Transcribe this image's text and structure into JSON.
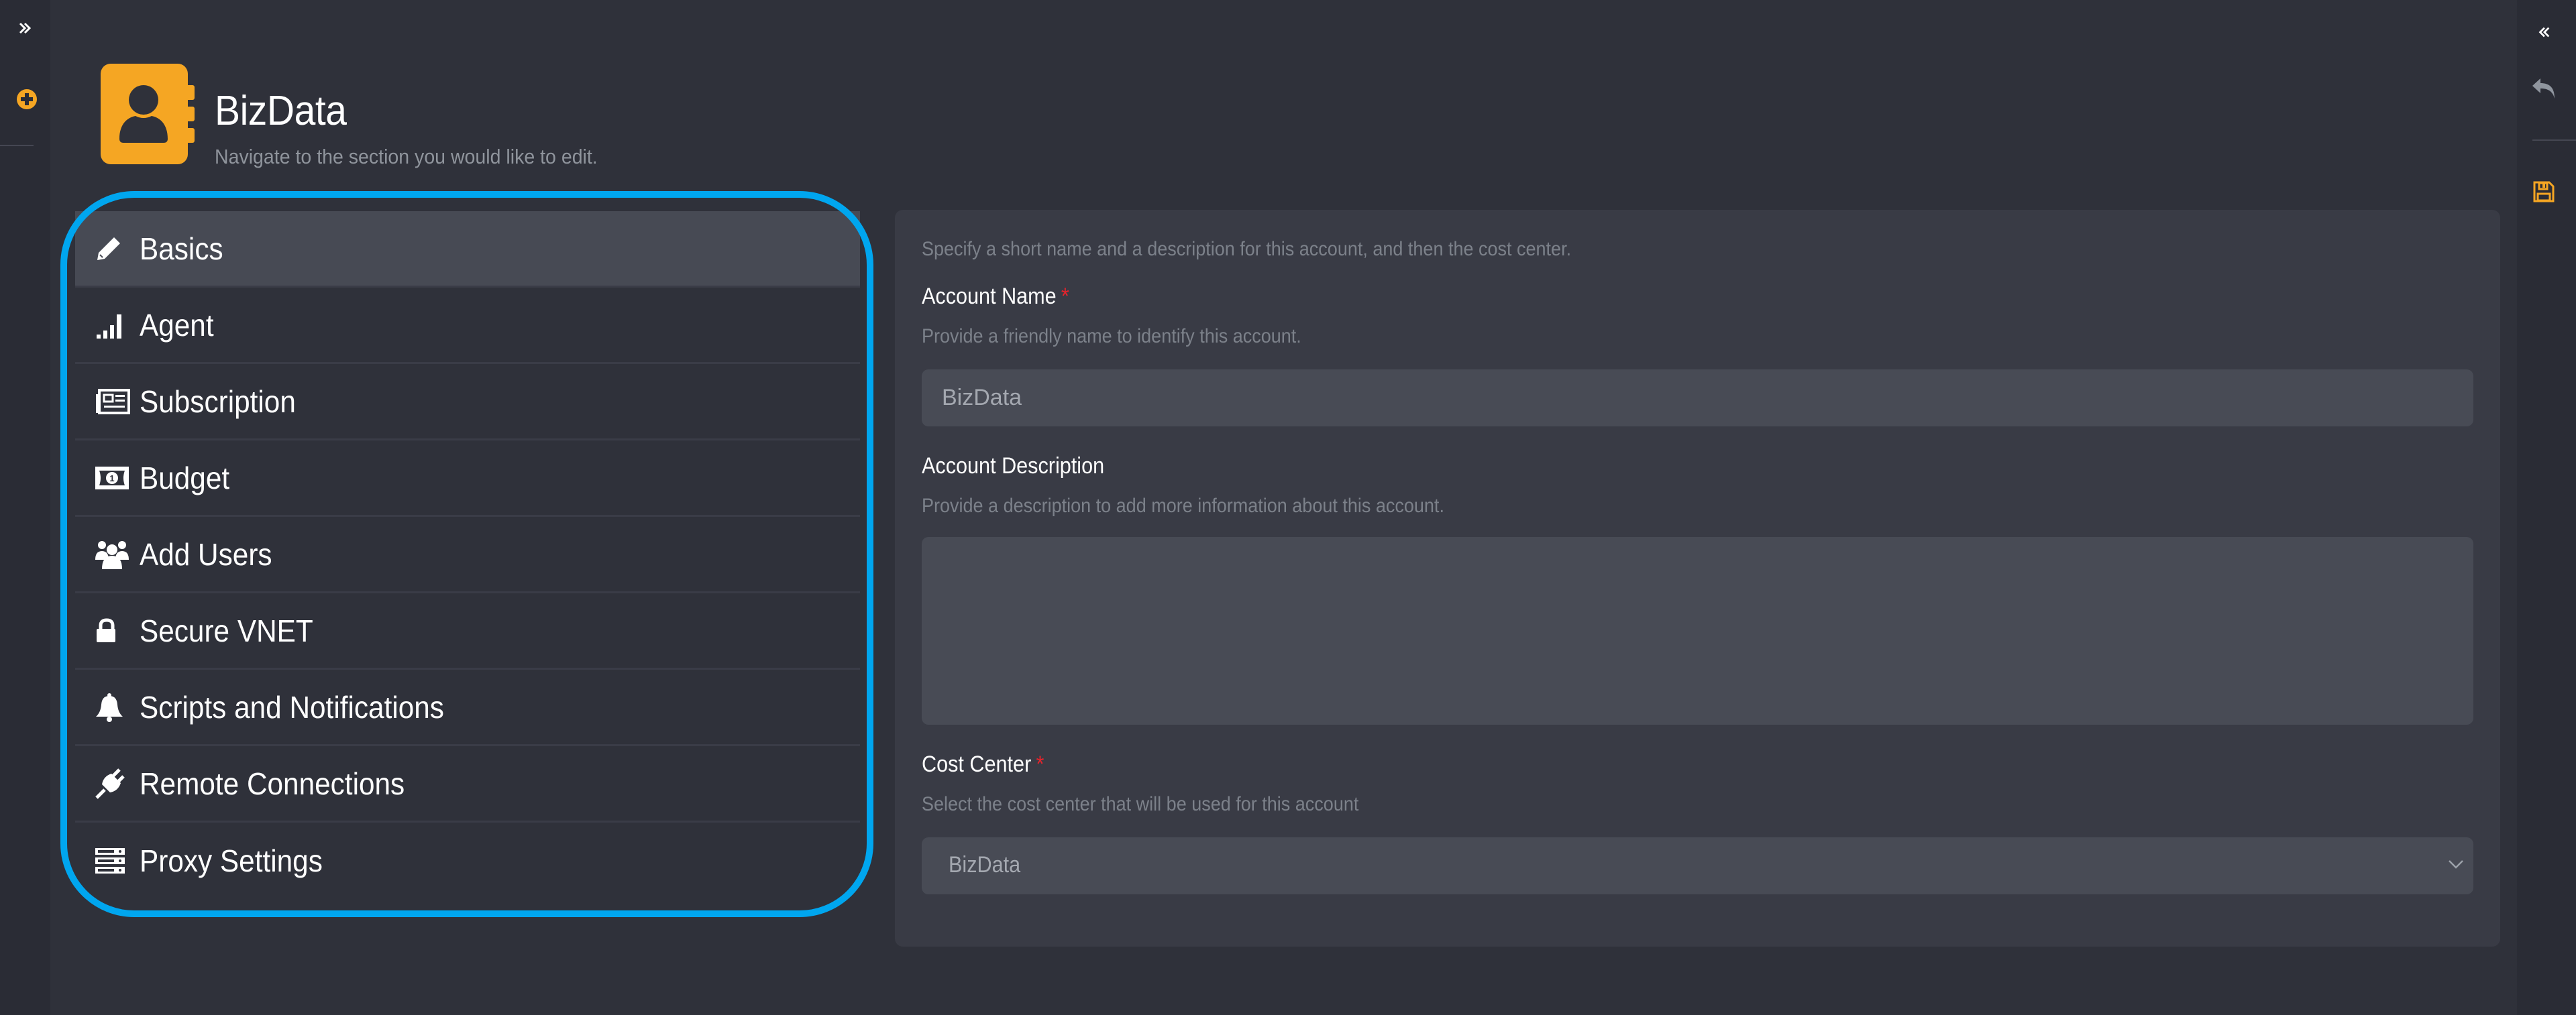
{
  "left_rail": {
    "expand_icon": "chevrons-right-icon",
    "add_icon": "plus-circle-icon"
  },
  "right_rail": {
    "collapse_icon": "chevrons-left-icon",
    "undo_icon": "undo-icon",
    "save_icon": "save-icon"
  },
  "header": {
    "title": "BizData",
    "subtitle": "Navigate to the section you would like to edit.",
    "logo_icon": "address-book-icon"
  },
  "nav": {
    "items": [
      {
        "label": "Basics",
        "icon": "pencil-icon",
        "active": true
      },
      {
        "label": "Agent",
        "icon": "signal-icon",
        "active": false
      },
      {
        "label": "Subscription",
        "icon": "newspaper-icon",
        "active": false
      },
      {
        "label": "Budget",
        "icon": "money-bill-icon",
        "active": false
      },
      {
        "label": "Add Users",
        "icon": "users-icon",
        "active": false
      },
      {
        "label": "Secure VNET",
        "icon": "lock-icon",
        "active": false
      },
      {
        "label": "Scripts and Notifications",
        "icon": "bell-icon",
        "active": false
      },
      {
        "label": "Remote Connections",
        "icon": "plug-icon",
        "active": false
      },
      {
        "label": "Proxy Settings",
        "icon": "server-icon",
        "active": false
      }
    ]
  },
  "form": {
    "intro": "Specify a short name and a description for this account, and then the cost center.",
    "account_name": {
      "label": "Account Name",
      "required_mark": "*",
      "help": "Provide a friendly name to identify this account.",
      "value": "BizData"
    },
    "account_description": {
      "label": "Account Description",
      "help": "Provide a description to add more information about this account.",
      "value": ""
    },
    "cost_center": {
      "label": "Cost Center",
      "required_mark": "*",
      "help": "Select the cost center that will be used for this account",
      "selected": "BizData"
    }
  },
  "colors": {
    "accent": "#f5a623",
    "highlight": "#00a6ef",
    "required": "#e8232b",
    "background": "#2f313a",
    "panel": "#393b45",
    "input": "#484b55",
    "active_nav": "#474a54"
  }
}
